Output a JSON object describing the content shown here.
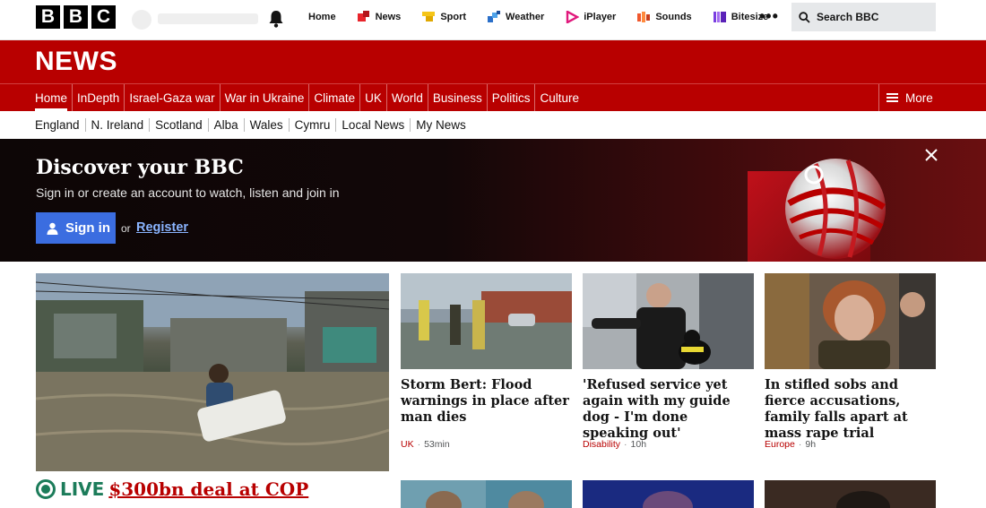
{
  "logo": {
    "letters": [
      "B",
      "B",
      "C"
    ]
  },
  "topnav": {
    "items": [
      {
        "label": "Home",
        "icon": "none"
      },
      {
        "label": "News",
        "icon": "news-icon",
        "color": "#e8242b"
      },
      {
        "label": "Sport",
        "icon": "sport-icon",
        "color": "#f5c518"
      },
      {
        "label": "Weather",
        "icon": "weather-icon",
        "color": "#2a6fc9"
      },
      {
        "label": "iPlayer",
        "icon": "iplayer-icon",
        "color": "#e0187c"
      },
      {
        "label": "Sounds",
        "icon": "sounds-icon",
        "color": "#f0582d"
      },
      {
        "label": "Bitesize",
        "icon": "bitesize-icon",
        "color": "#7a3ee0"
      }
    ],
    "more_glyph": "•••",
    "search_label": "Search BBC"
  },
  "masthead": {
    "title": "NEWS"
  },
  "nav": {
    "items": [
      "Home",
      "InDepth",
      "Israel-Gaza war",
      "War in Ukraine",
      "Climate",
      "UK",
      "World",
      "Business",
      "Politics",
      "Culture"
    ],
    "more_label": "More"
  },
  "subnav": {
    "items": [
      "England",
      "N. Ireland",
      "Scotland",
      "Alba",
      "Wales",
      "Cymru",
      "Local News",
      "My News"
    ]
  },
  "promo": {
    "heading": "Discover your BBC",
    "subtext": "Sign in or create an account to watch, listen and join in",
    "signin_label": "Sign in",
    "or_label": "or",
    "register_label": "Register"
  },
  "stories": [
    {
      "title": "Storm Bert: Flood warnings in place after man dies",
      "tag": "UK",
      "time": "53min"
    },
    {
      "title": "'Refused service yet again with my guide dog - I'm done speaking out'",
      "tag": "Disability",
      "time": "10h"
    },
    {
      "title": "In stifled sobs and fierce accusations, family falls apart at mass rape trial",
      "tag": "Europe",
      "time": "9h"
    }
  ],
  "live": {
    "label": "LIVE",
    "headline": "$300bn deal at COP"
  },
  "colors": {
    "brand_red": "#b80000",
    "signin_blue": "#3b6de0",
    "live_green": "#1c7c5a"
  }
}
